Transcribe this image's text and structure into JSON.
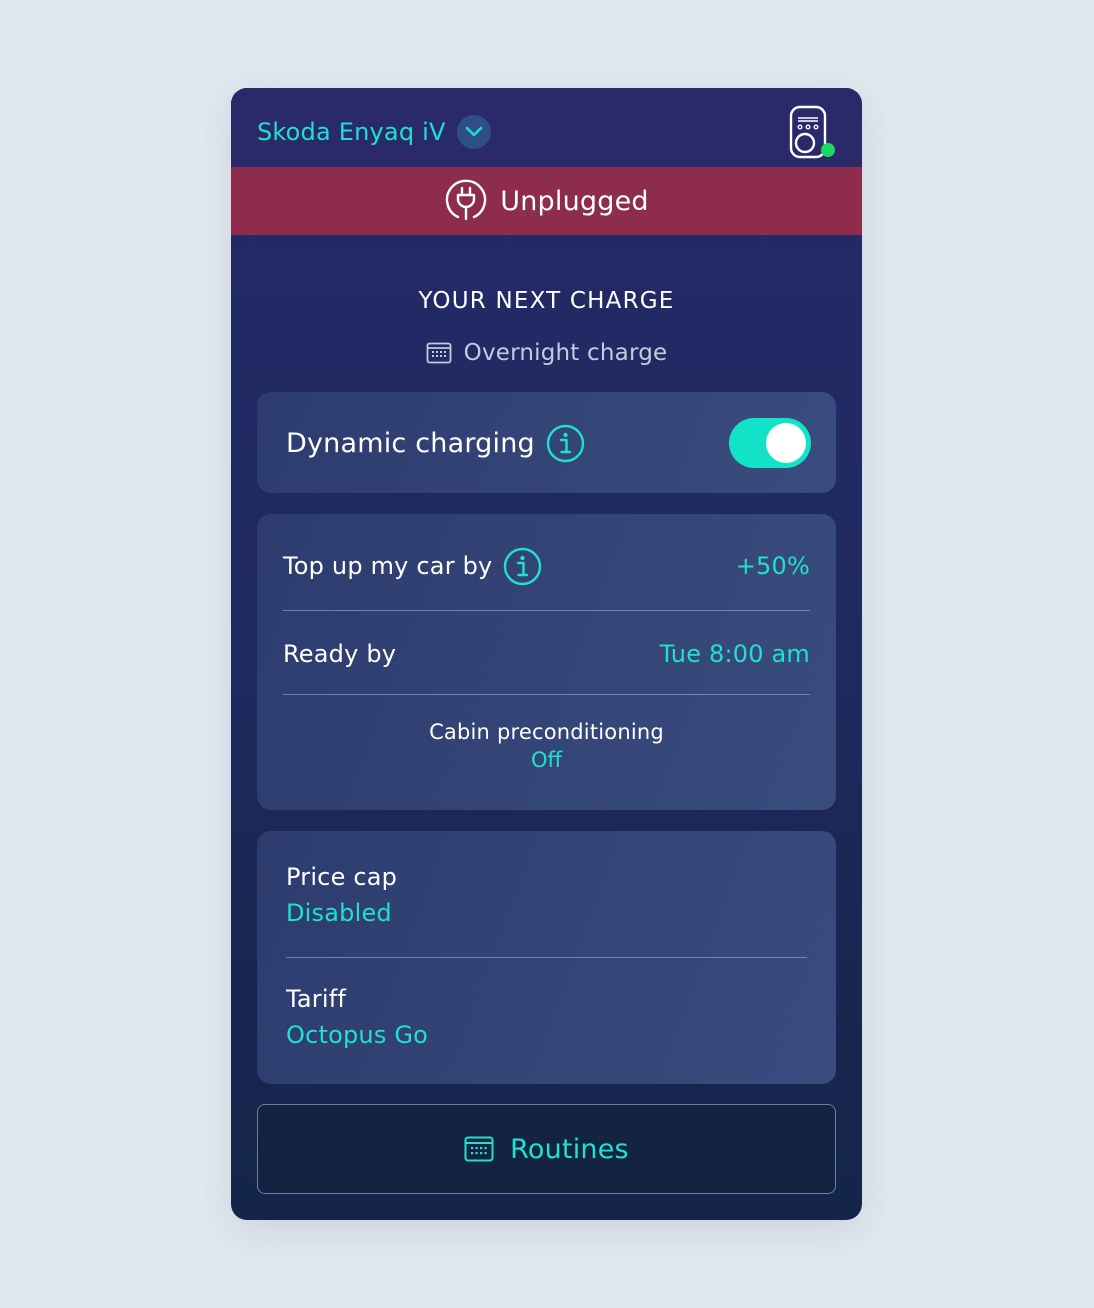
{
  "header": {
    "vehicle_name": "Skoda Enyaq iV",
    "dropdown_icon": "chevron-down-icon",
    "charger_icon": "ev-charger-icon",
    "charger_online_color": "#1ed760"
  },
  "status": {
    "text": "Unplugged",
    "icon": "plug-icon",
    "color": "#8e2c4e"
  },
  "next_charge": {
    "title": "YOUR NEXT CHARGE",
    "schedule_icon": "calendar-icon",
    "schedule_name": "Overnight charge"
  },
  "dynamic_charging": {
    "label": "Dynamic charging",
    "info_icon": "info-icon",
    "enabled": true
  },
  "charge_settings": {
    "top_up_label": "Top up my car by",
    "top_up_value": "+50%",
    "ready_by_label": "Ready by",
    "ready_by_value": "Tue 8:00 am",
    "cabin_label": "Cabin preconditioning",
    "cabin_value": "Off"
  },
  "pricing": {
    "price_cap_label": "Price cap",
    "price_cap_value": "Disabled",
    "tariff_label": "Tariff",
    "tariff_value": "Octopus Go"
  },
  "routines_button": {
    "label": "Routines",
    "icon": "calendar-icon"
  },
  "colors": {
    "accent": "#20e0d0",
    "toggle_on": "#12e3c8",
    "card_bg": "#1f2a60"
  }
}
